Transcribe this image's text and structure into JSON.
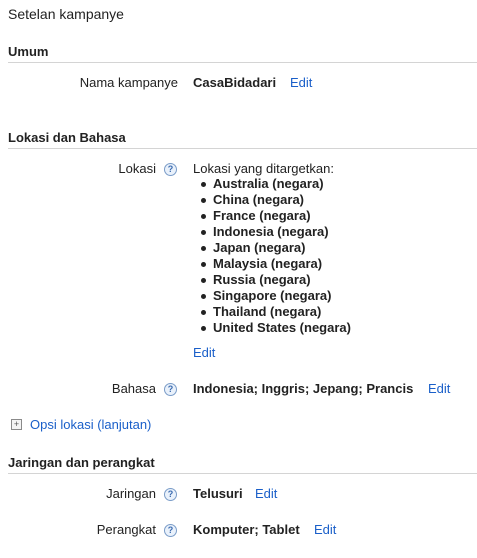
{
  "page": {
    "title": "Setelan kampanye"
  },
  "sections": {
    "umum": {
      "heading": "Umum",
      "campaign_name": {
        "label": "Nama kampanye",
        "value": "CasaBidadari",
        "edit": "Edit"
      }
    },
    "lokasi_bahasa": {
      "heading": "Lokasi dan Bahasa",
      "lokasi": {
        "label": "Lokasi",
        "help_icon": "help-icon",
        "intro": "Lokasi yang ditargetkan:",
        "items": [
          "Australia (negara)",
          "China (negara)",
          "France (negara)",
          "Indonesia (negara)",
          "Japan (negara)",
          "Malaysia (negara)",
          "Russia (negara)",
          "Singapore (negara)",
          "Thailand (negara)",
          "United States (negara)"
        ],
        "edit": "Edit"
      },
      "bahasa": {
        "label": "Bahasa",
        "value": "Indonesia; Inggris; Jepang; Prancis",
        "edit": "Edit"
      },
      "advanced": {
        "label": "Opsi lokasi (lanjutan)",
        "icon": "plus-square-icon"
      }
    },
    "jaringan": {
      "heading": "Jaringan dan perangkat",
      "jaringan": {
        "label": "Jaringan",
        "value": "Telusuri",
        "edit": "Edit"
      },
      "perangkat": {
        "label": "Perangkat",
        "value": "Komputer; Tablet",
        "edit": "Edit"
      }
    }
  },
  "colors": {
    "link": "#1a5fc9",
    "divider": "#d4d4d4",
    "text": "#222222"
  }
}
